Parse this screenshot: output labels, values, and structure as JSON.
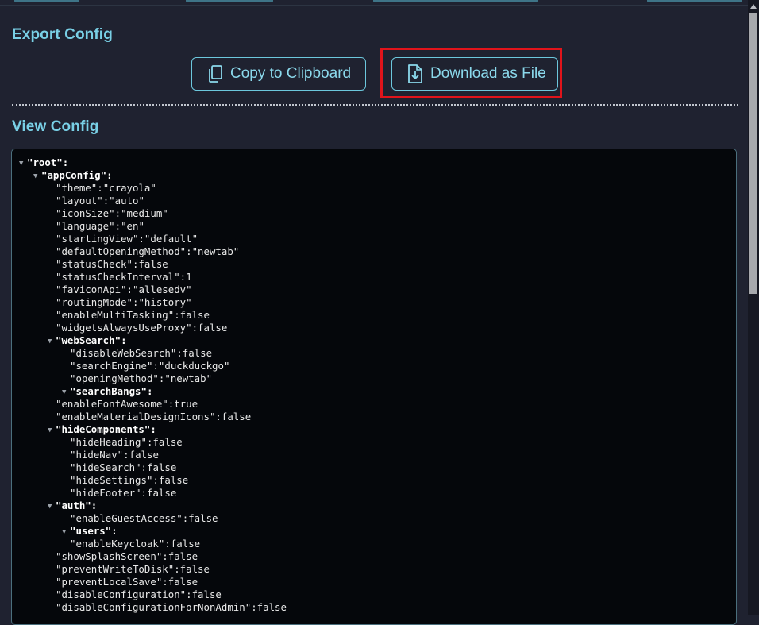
{
  "export": {
    "title": "Export Config",
    "copy_label": "Copy to Clipboard",
    "download_label": "Download as File"
  },
  "view": {
    "title": "View Config"
  },
  "config_lines": [
    {
      "indent": 0,
      "type": "node",
      "key": "\"root\"",
      "sep": ":",
      "value": ""
    },
    {
      "indent": 1,
      "type": "node",
      "key": "\"appConfig\"",
      "sep": ":",
      "value": ""
    },
    {
      "indent": 2,
      "type": "leaf",
      "key": "\"theme\"",
      "sep": ":",
      "value": "\"crayola\""
    },
    {
      "indent": 2,
      "type": "leaf",
      "key": "\"layout\"",
      "sep": ":",
      "value": "\"auto\""
    },
    {
      "indent": 2,
      "type": "leaf",
      "key": "\"iconSize\"",
      "sep": ":",
      "value": "\"medium\""
    },
    {
      "indent": 2,
      "type": "leaf",
      "key": "\"language\"",
      "sep": ":",
      "value": "\"en\""
    },
    {
      "indent": 2,
      "type": "leaf",
      "key": "\"startingView\"",
      "sep": ":",
      "value": "\"default\""
    },
    {
      "indent": 2,
      "type": "leaf",
      "key": "\"defaultOpeningMethod\"",
      "sep": ":",
      "value": "\"newtab\""
    },
    {
      "indent": 2,
      "type": "leaf",
      "key": "\"statusCheck\"",
      "sep": ":",
      "value": "false"
    },
    {
      "indent": 2,
      "type": "leaf",
      "key": "\"statusCheckInterval\"",
      "sep": ":",
      "value": "1"
    },
    {
      "indent": 2,
      "type": "leaf",
      "key": "\"faviconApi\"",
      "sep": ":",
      "value": "\"allesedv\""
    },
    {
      "indent": 2,
      "type": "leaf",
      "key": "\"routingMode\"",
      "sep": ":",
      "value": "\"history\""
    },
    {
      "indent": 2,
      "type": "leaf",
      "key": "\"enableMultiTasking\"",
      "sep": ":",
      "value": "false"
    },
    {
      "indent": 2,
      "type": "leaf",
      "key": "\"widgetsAlwaysUseProxy\"",
      "sep": ":",
      "value": "false"
    },
    {
      "indent": 2,
      "type": "node",
      "key": "\"webSearch\"",
      "sep": ":",
      "value": ""
    },
    {
      "indent": 3,
      "type": "leaf",
      "key": "\"disableWebSearch\"",
      "sep": ":",
      "value": "false"
    },
    {
      "indent": 3,
      "type": "leaf",
      "key": "\"searchEngine\"",
      "sep": ":",
      "value": "\"duckduckgo\""
    },
    {
      "indent": 3,
      "type": "leaf",
      "key": "\"openingMethod\"",
      "sep": ":",
      "value": "\"newtab\""
    },
    {
      "indent": 3,
      "type": "node",
      "key": "\"searchBangs\"",
      "sep": ":",
      "value": ""
    },
    {
      "indent": 2,
      "type": "leaf",
      "key": "\"enableFontAwesome\"",
      "sep": ":",
      "value": "true"
    },
    {
      "indent": 2,
      "type": "leaf",
      "key": "\"enableMaterialDesignIcons\"",
      "sep": ":",
      "value": "false"
    },
    {
      "indent": 2,
      "type": "node",
      "key": "\"hideComponents\"",
      "sep": ":",
      "value": ""
    },
    {
      "indent": 3,
      "type": "leaf",
      "key": "\"hideHeading\"",
      "sep": ":",
      "value": "false"
    },
    {
      "indent": 3,
      "type": "leaf",
      "key": "\"hideNav\"",
      "sep": ":",
      "value": "false"
    },
    {
      "indent": 3,
      "type": "leaf",
      "key": "\"hideSearch\"",
      "sep": ":",
      "value": "false"
    },
    {
      "indent": 3,
      "type": "leaf",
      "key": "\"hideSettings\"",
      "sep": ":",
      "value": "false"
    },
    {
      "indent": 3,
      "type": "leaf",
      "key": "\"hideFooter\"",
      "sep": ":",
      "value": "false"
    },
    {
      "indent": 2,
      "type": "node",
      "key": "\"auth\"",
      "sep": ":",
      "value": ""
    },
    {
      "indent": 3,
      "type": "leaf",
      "key": "\"enableGuestAccess\"",
      "sep": ":",
      "value": "false"
    },
    {
      "indent": 3,
      "type": "node",
      "key": "\"users\"",
      "sep": ":",
      "value": ""
    },
    {
      "indent": 3,
      "type": "leaf",
      "key": "\"enableKeycloak\"",
      "sep": ":",
      "value": "false"
    },
    {
      "indent": 2,
      "type": "leaf",
      "key": "\"showSplashScreen\"",
      "sep": ":",
      "value": "false"
    },
    {
      "indent": 2,
      "type": "leaf",
      "key": "\"preventWriteToDisk\"",
      "sep": ":",
      "value": "false"
    },
    {
      "indent": 2,
      "type": "leaf",
      "key": "\"preventLocalSave\"",
      "sep": ":",
      "value": "false"
    },
    {
      "indent": 2,
      "type": "leaf",
      "key": "\"disableConfiguration\"",
      "sep": ":",
      "value": "false"
    },
    {
      "indent": 2,
      "type": "leaf",
      "key": "\"disableConfigurationForNonAdmin\"",
      "sep": ":",
      "value": "false"
    }
  ],
  "icons": {
    "copy": "copy-icon",
    "download": "download-file-icon",
    "expand": "triangle-down-icon"
  },
  "colors": {
    "background": "#1f2230",
    "accent": "#79d0e6",
    "code_bg": "#05070b",
    "highlight": "#e0141b"
  }
}
